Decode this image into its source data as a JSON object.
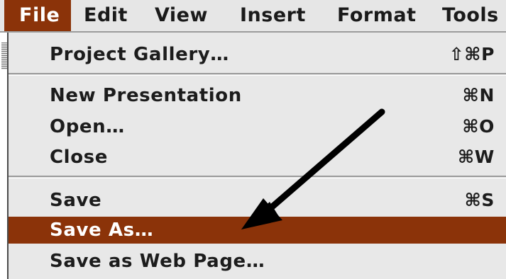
{
  "menubar": {
    "items": [
      {
        "label": "File",
        "active": true
      },
      {
        "label": "Edit"
      },
      {
        "label": "View"
      },
      {
        "label": "Insert"
      },
      {
        "label": "Format"
      },
      {
        "label": "Tools"
      }
    ]
  },
  "menu": {
    "items": [
      {
        "label": "Project Gallery…",
        "shortcut": "⇧⌘P"
      },
      {
        "label": "New Presentation",
        "shortcut": "⌘N"
      },
      {
        "label": "Open…",
        "shortcut": "⌘O"
      },
      {
        "label": "Close",
        "shortcut": "⌘W"
      },
      {
        "label": "Save",
        "shortcut": "⌘S"
      },
      {
        "label": "Save As…",
        "shortcut": "",
        "selected": true
      },
      {
        "label": "Save as Web Page…",
        "shortcut": ""
      }
    ]
  },
  "colors": {
    "highlight": "#8b3309",
    "menu_background": "#e8e8e8",
    "menubar_background": "#e6e6e6",
    "text": "#1c1c1c",
    "arrow": "#000000"
  },
  "icons": {
    "arrow": "annotation-arrow-icon",
    "grip": "menu-grip-icon"
  }
}
